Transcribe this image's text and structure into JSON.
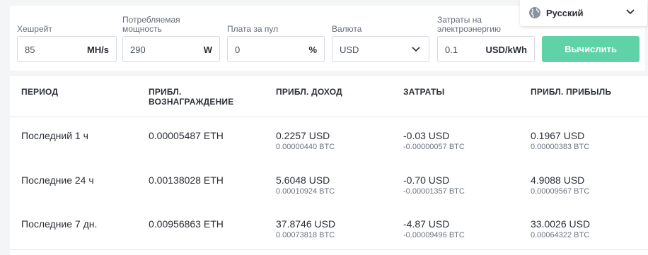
{
  "calculator": {
    "hashrate": {
      "label": "Хешрейт",
      "value": "85",
      "unit": "MH/s"
    },
    "power": {
      "label": "Потребляемая\nмощность",
      "value": "290",
      "unit": "W"
    },
    "pool_fee": {
      "label": "Плата за пул",
      "value": "0",
      "unit": "%"
    },
    "currency": {
      "label": "Валюта",
      "value": "USD"
    },
    "electricity": {
      "label": "Затраты на\nэлектроэнергию",
      "value": "0.1",
      "unit": "USD/kWh"
    },
    "calculate_button": "Вычислить"
  },
  "language": {
    "label": "Русский"
  },
  "colors": {
    "accent": "#5fd3a7"
  },
  "icons": {
    "globe": "globe-icon",
    "chevron": "chevron-down-icon"
  },
  "table": {
    "headers": {
      "period": "ПЕРИОД",
      "reward": "ПРИБЛ.\nВОЗНАГРАЖДЕНИЕ",
      "revenue": "ПРИБЛ. ДОХОД",
      "cost": "ЗАТРАТЫ",
      "profit": "ПРИБЛ. ПРИБЫЛЬ"
    },
    "rows": [
      {
        "period": "Последний 1 ч",
        "reward": "0.00005487 ETH",
        "revenue": "0.2257 USD",
        "revenue_btc": "0.00000440 BTC",
        "cost": "-0.03 USD",
        "cost_btc": "-0.00000057 BTC",
        "profit": "0.1967 USD",
        "profit_btc": "0.00000383 BTC"
      },
      {
        "period": "Последние 24 ч",
        "reward": "0.00138028 ETH",
        "revenue": "5.6048 USD",
        "revenue_btc": "0.00010924 BTC",
        "cost": "-0.70 USD",
        "cost_btc": "-0.00001357 BTC",
        "profit": "4.9088 USD",
        "profit_btc": "0.00009567 BTC"
      },
      {
        "period": "Последние 7 дн.",
        "reward": "0.00956863 ETH",
        "revenue": "37.8746 USD",
        "revenue_btc": "0.00073818 BTC",
        "cost": "-4.87 USD",
        "cost_btc": "-0.00009496 BTC",
        "profit": "33.0026 USD",
        "profit_btc": "0.00064322 BTC"
      }
    ]
  }
}
